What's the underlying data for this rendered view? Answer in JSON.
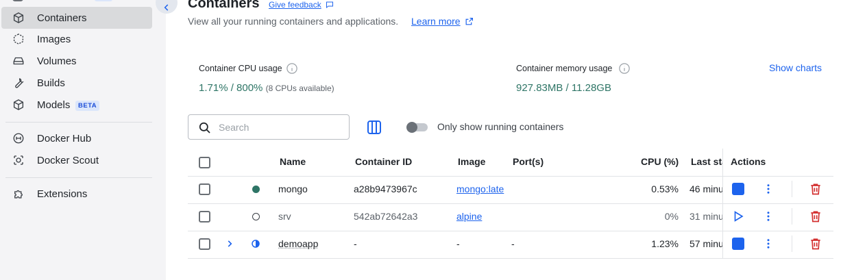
{
  "sidebar": {
    "items": [
      {
        "label": "Containers",
        "icon": "cube-icon",
        "active": true
      },
      {
        "label": "Images",
        "icon": "image-layers-icon"
      },
      {
        "label": "Volumes",
        "icon": "disk-icon"
      },
      {
        "label": "Builds",
        "icon": "wrench-icon"
      },
      {
        "label": "Models",
        "icon": "model-cube-icon",
        "badge": "BETA"
      },
      {
        "label": "Docker Hub",
        "icon": "docker-hub-icon"
      },
      {
        "label": "Docker Scout",
        "icon": "scout-icon"
      },
      {
        "label": "Extensions",
        "icon": "puzzle-icon"
      }
    ]
  },
  "header": {
    "title": "Containers",
    "feedback_label": "Give feedback",
    "subtitle": "View all your running containers and applications.",
    "learn_more": "Learn more"
  },
  "stats": {
    "cpu_label": "Container CPU usage",
    "cpu_value": "1.71% / 800%",
    "cpu_note": "(8 CPUs available)",
    "mem_label": "Container memory usage",
    "mem_value": "927.83MB / 11.28GB",
    "show_charts": "Show charts"
  },
  "toolbar": {
    "search_placeholder": "Search",
    "toggle_label": "Only show running containers"
  },
  "table": {
    "headers": {
      "name": "Name",
      "container_id": "Container ID",
      "image": "Image",
      "ports": "Port(s)",
      "cpu": "CPU (%)",
      "last_started": "Last sta",
      "actions": "Actions"
    },
    "rows": [
      {
        "name": "mongo",
        "container_id": "a28b9473967c",
        "image": "mongo:late",
        "ports": "",
        "cpu": "0.53%",
        "last_started": "46 minu",
        "status": "running",
        "action": "stop"
      },
      {
        "name": "srv",
        "container_id": "542ab72642a3",
        "image": "alpine",
        "ports": "",
        "cpu": "0%",
        "last_started": "31 minu",
        "status": "exited",
        "action": "start"
      },
      {
        "name": "demoapp",
        "container_id": "-",
        "image": "-",
        "ports": "-",
        "cpu": "1.23%",
        "last_started": "57 minu",
        "status": "partial",
        "action": "stop"
      }
    ]
  },
  "colors": {
    "accent": "#1d63ed",
    "running": "#2e7566",
    "danger": "#d32f2f"
  }
}
